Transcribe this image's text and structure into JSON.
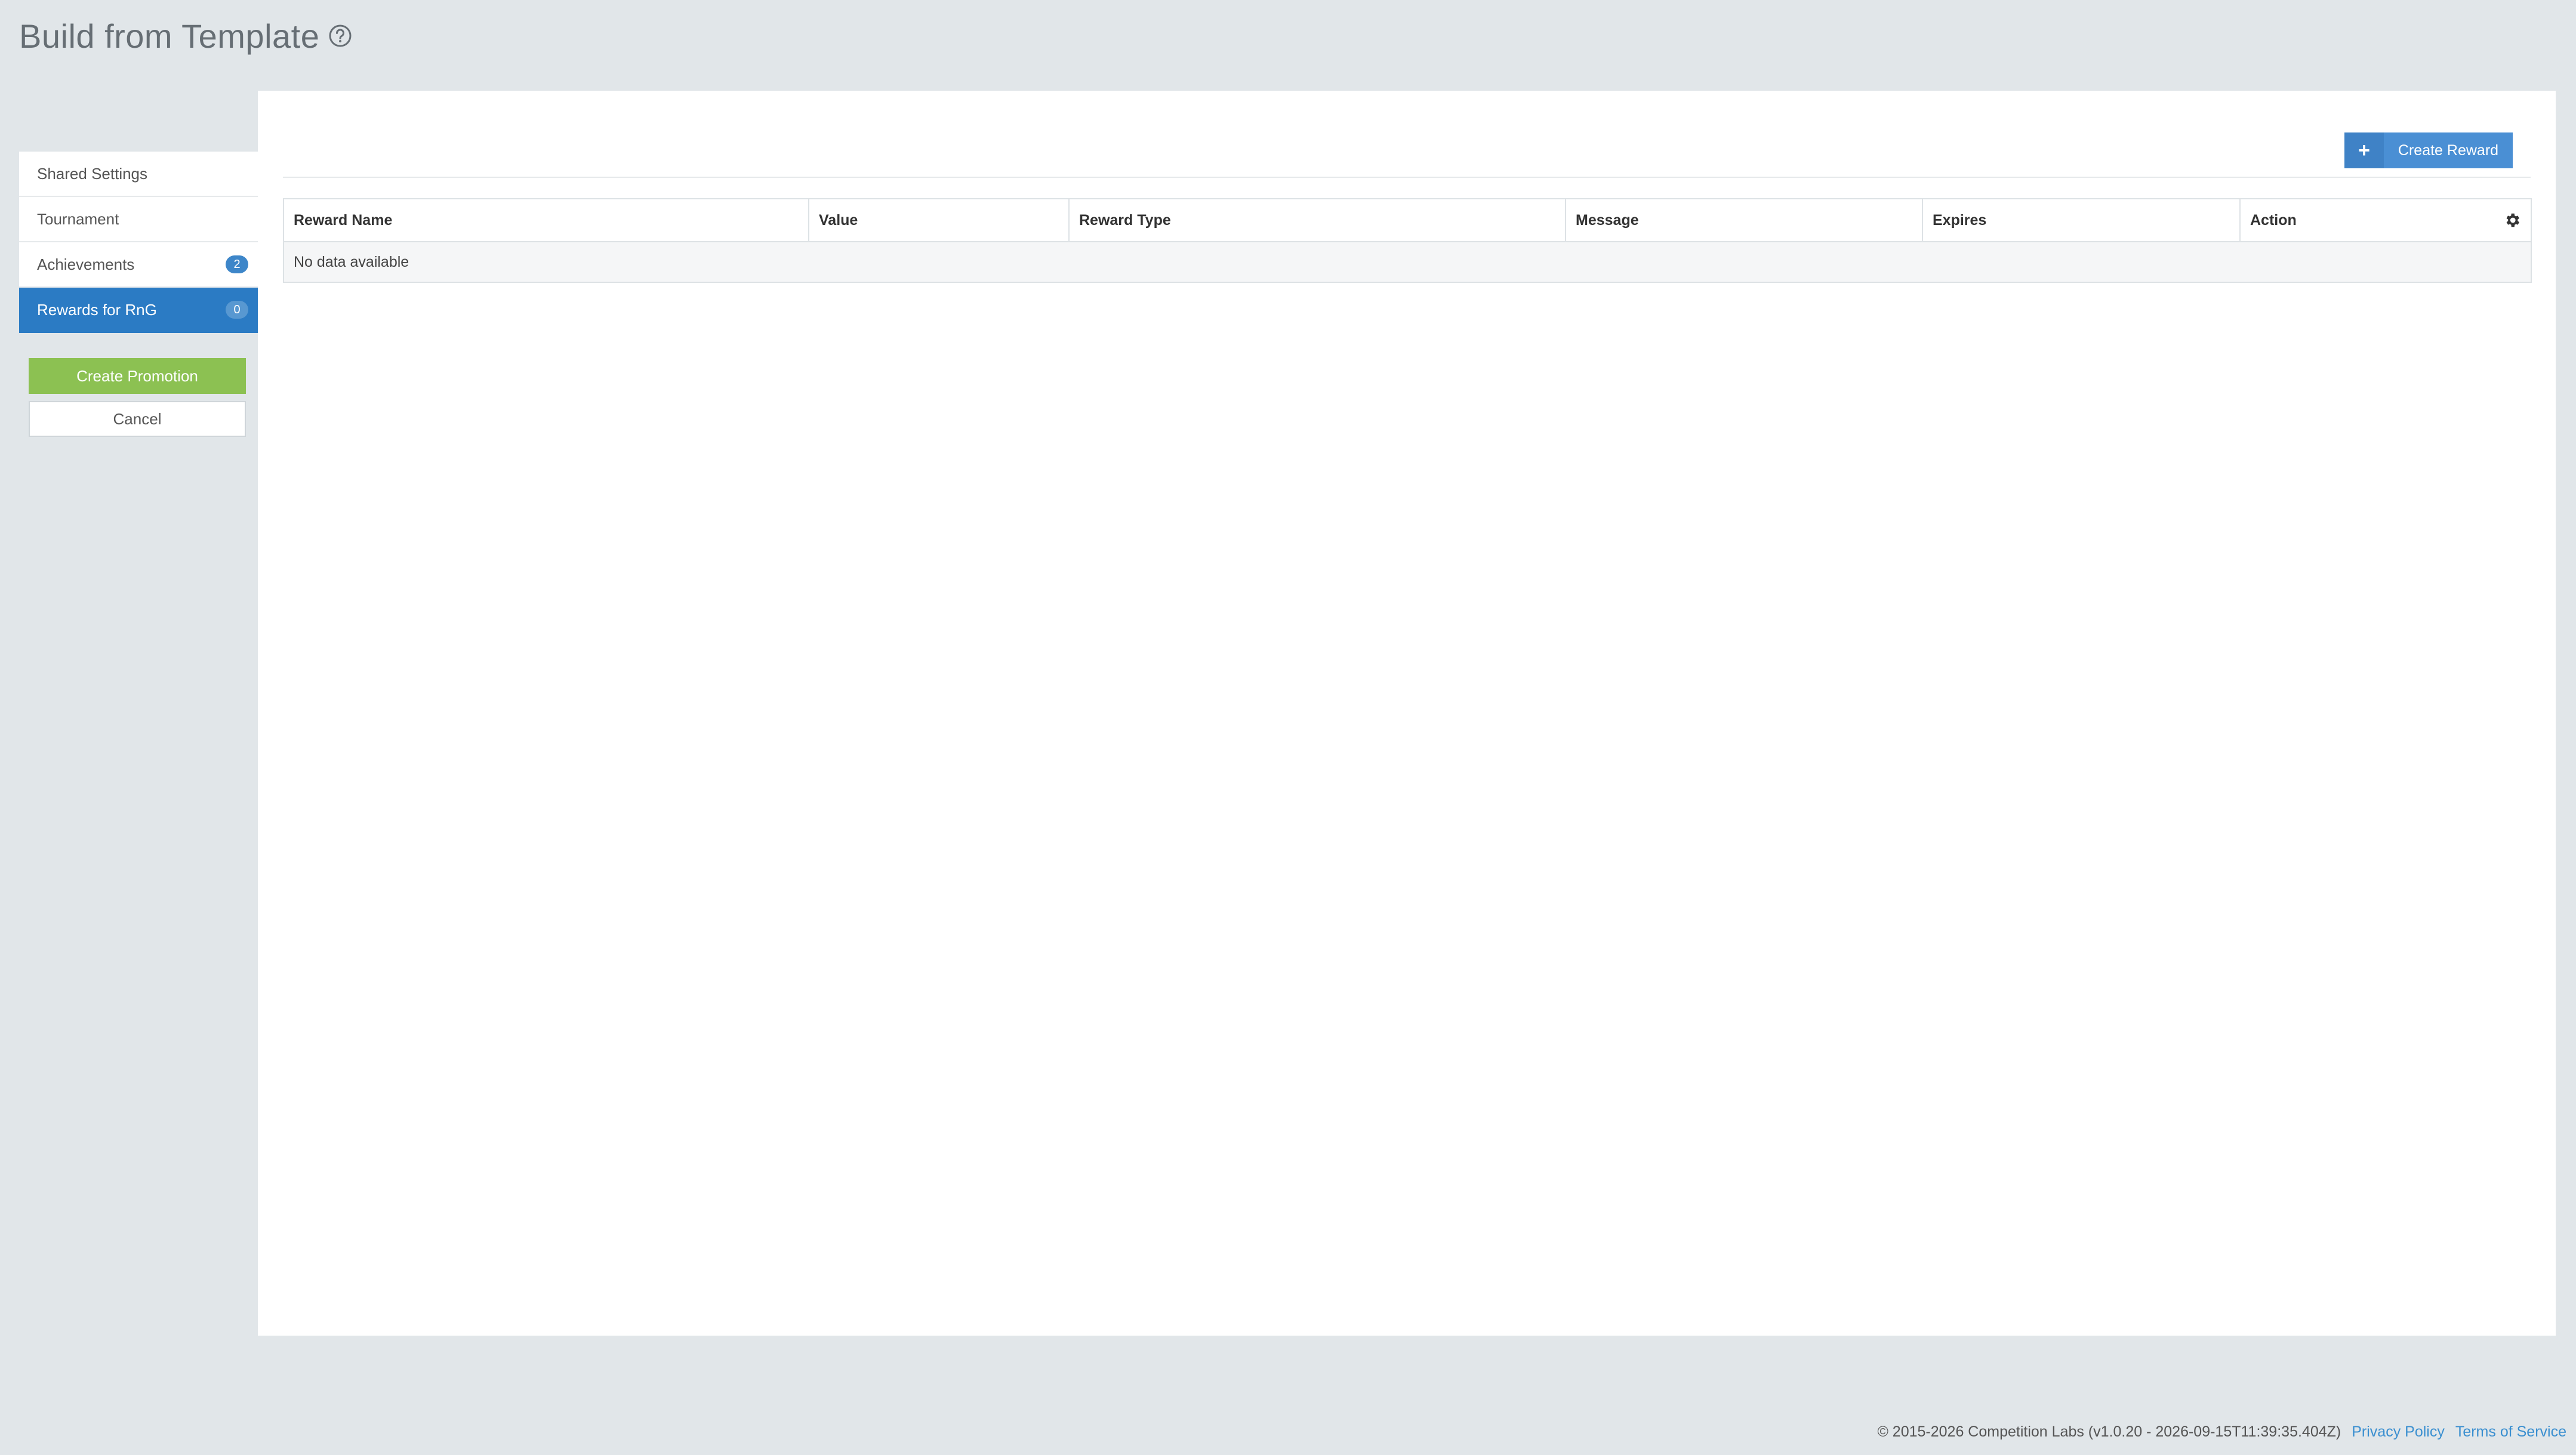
{
  "page": {
    "title": "Build from Template"
  },
  "sidebar": {
    "items": [
      {
        "label": "Shared Settings",
        "badge": null
      },
      {
        "label": "Tournament",
        "badge": null
      },
      {
        "label": "Achievements",
        "badge": "2"
      },
      {
        "label": "Rewards for RnG",
        "badge": "0",
        "active": true
      }
    ],
    "create_promotion_label": "Create Promotion",
    "cancel_label": "Cancel"
  },
  "toolbar": {
    "create_reward_label": "Create Reward",
    "create_reward_icon": "+"
  },
  "table": {
    "columns": [
      "Reward Name",
      "Value",
      "Reward Type",
      "Message",
      "Expires",
      "Action"
    ],
    "empty_message": "No data available"
  },
  "footer": {
    "copyright": "© 2015-2026 Competition Labs (v1.0.20 - 2026-09-15T11:39:35.404Z)",
    "privacy_label": "Privacy Policy",
    "terms_label": "Terms of Service"
  },
  "colors": {
    "background": "#e1e6e9",
    "active_nav": "#2b7bc4",
    "create_promotion": "#8cc152",
    "create_reward": "#4a8fd4",
    "link": "#3a8fd0"
  }
}
